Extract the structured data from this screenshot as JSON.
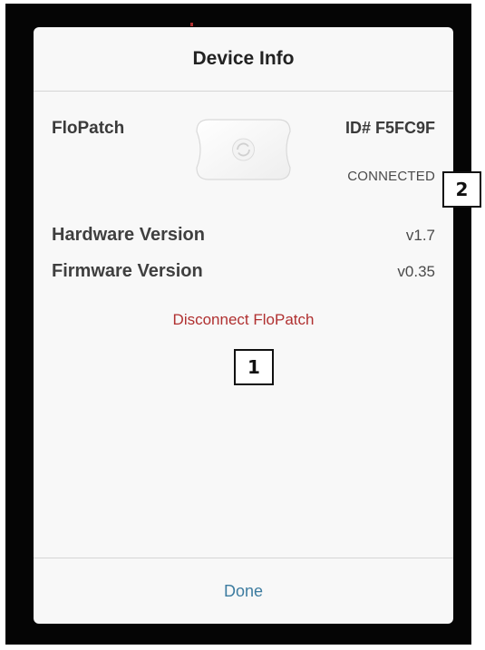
{
  "dialog": {
    "title": "Device Info"
  },
  "device": {
    "name": "FloPatch",
    "id": "ID# F5FC9F",
    "status": "CONNECTED",
    "image_icon": "flopatch-device-icon"
  },
  "versions": {
    "hardware_label": "Hardware Version",
    "hardware_value": "v1.7",
    "firmware_label": "Firmware Version",
    "firmware_value": "v0.35"
  },
  "actions": {
    "disconnect_label": "Disconnect FloPatch",
    "done_label": "Done"
  },
  "callouts": {
    "one": "1",
    "two": "2"
  },
  "colors": {
    "disconnect": "#b03030",
    "done": "#3d7ca0",
    "frame": "#050505",
    "dialog_bg": "#f8f8f8"
  }
}
